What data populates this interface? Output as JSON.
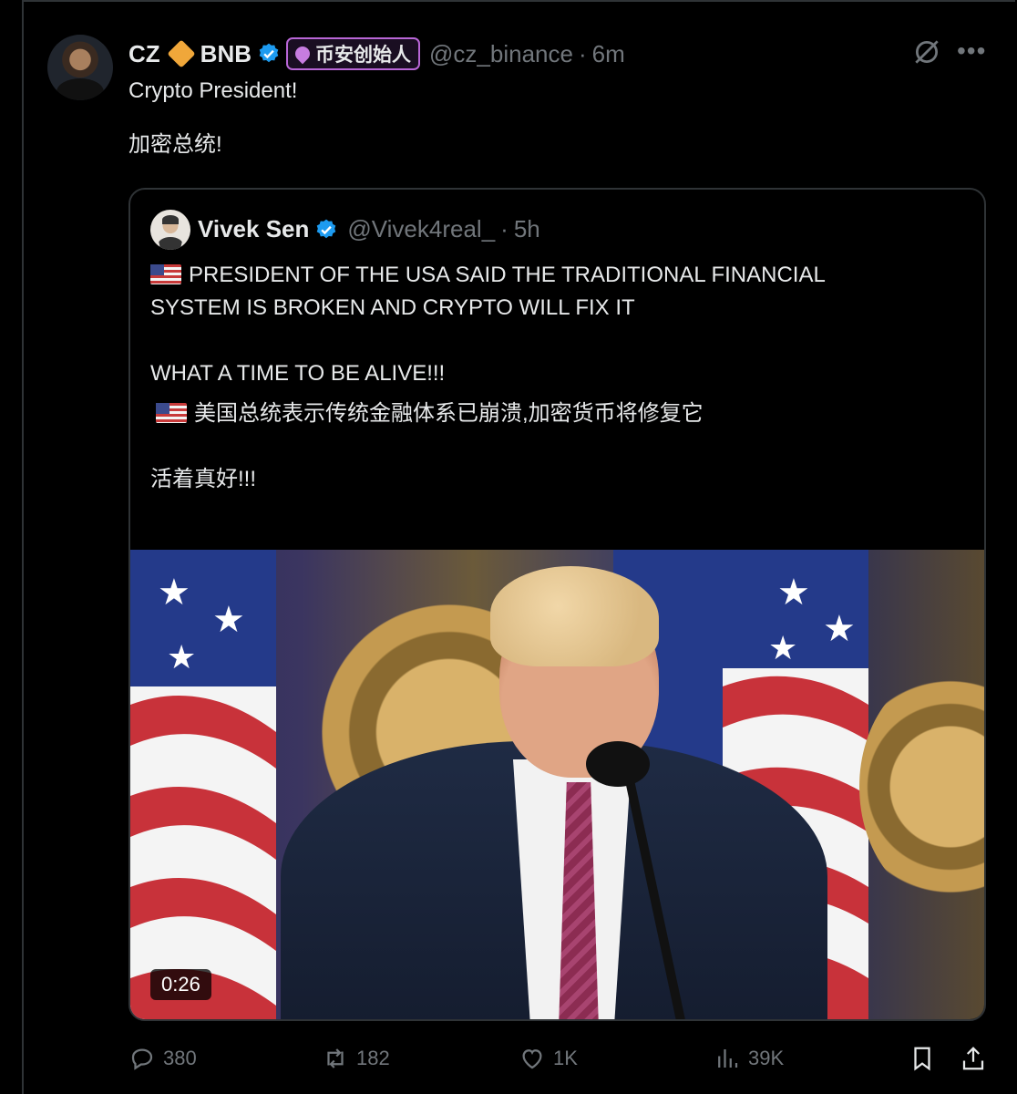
{
  "tweet": {
    "author_name": "CZ",
    "author_name_suffix": "BNB",
    "affiliation_badge": "币安创始人",
    "handle": "@cz_binance",
    "separator": "·",
    "time": "6m",
    "text_line1": "Crypto President!",
    "text_line2": "加密总统!",
    "icons": [
      "avatar",
      "diamond-icon",
      "verified-icon",
      "grok-icon",
      "more-icon"
    ]
  },
  "quoted_tweet": {
    "author_name": "Vivek Sen",
    "handle": "@Vivek4real_",
    "separator": "·",
    "time": "5h",
    "line1": "PRESIDENT OF THE USA SAID THE TRADITIONAL FINANCIAL",
    "line2": "SYSTEM IS BROKEN AND CRYPTO WILL FIX IT",
    "line3": "WHAT A TIME TO BE ALIVE!!!",
    "line4": "美国总统表示传统金融体系已崩溃,加密货币将修复它",
    "line5": "活着真好!!!",
    "video_duration": "0:26"
  },
  "actions": {
    "replies": "380",
    "retweets": "182",
    "likes": "1K",
    "views": "39K"
  },
  "colors": {
    "background": "#000000",
    "text": "#e7e9ea",
    "muted": "#71767b",
    "border": "#2f3336",
    "verified": "#1d9bf0",
    "badge_border": "#b866d6",
    "diamond": "#f0a73a"
  }
}
